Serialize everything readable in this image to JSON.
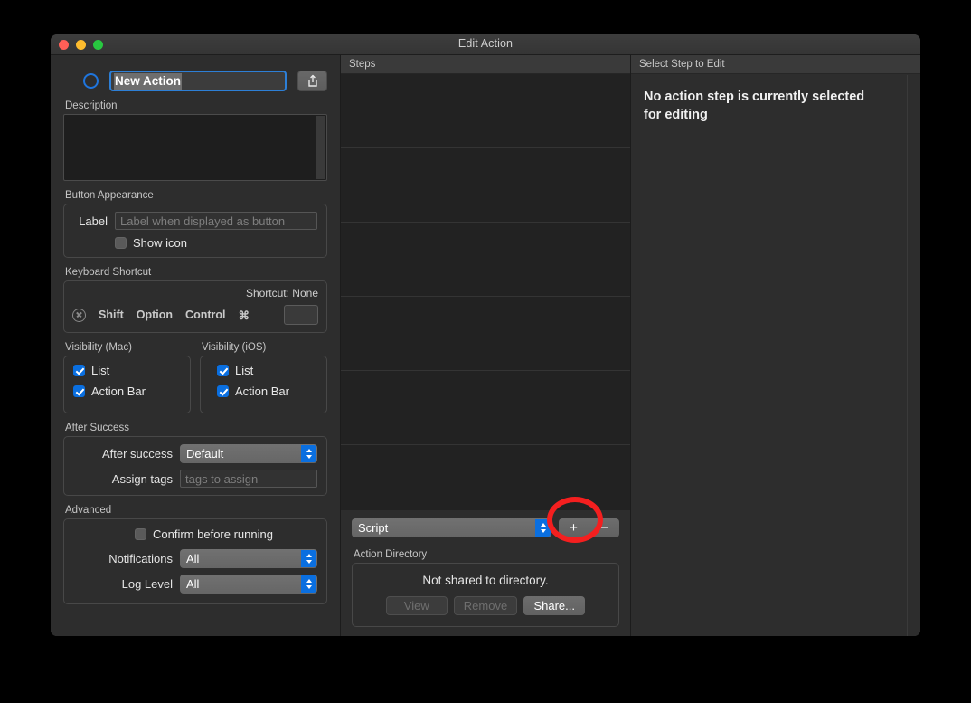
{
  "window": {
    "title": "Edit Action",
    "traffic_lights": [
      "close-button",
      "minimize-button",
      "zoom-button"
    ]
  },
  "left_panel": {
    "icon_well": "action-icon-well",
    "name_field": {
      "value": "New Action",
      "selected": true
    },
    "share_button_icon": "share-icon",
    "description": {
      "label": "Description",
      "value": "",
      "placeholder": ""
    },
    "button_appearance": {
      "label": "Button Appearance",
      "field_label": "Label",
      "field_value": "",
      "field_placeholder": "Label when displayed as button",
      "show_icon": {
        "label": "Show icon",
        "checked": false
      }
    },
    "keyboard_shortcut": {
      "label": "Keyboard Shortcut",
      "status": "Shortcut: None",
      "clear_icon": "clear-shortcut-icon",
      "modifiers": [
        "Shift",
        "Option",
        "Control",
        "⌘"
      ],
      "key_value": ""
    },
    "visibility_mac": {
      "label": "Visibility (Mac)",
      "items": [
        {
          "label": "List",
          "checked": true
        },
        {
          "label": "Action Bar",
          "checked": true
        }
      ]
    },
    "visibility_ios": {
      "label": "Visibility (iOS)",
      "items": [
        {
          "label": "List",
          "checked": true
        },
        {
          "label": "Action Bar",
          "checked": true
        }
      ]
    },
    "after_success": {
      "label": "After Success",
      "after_success_label": "After success",
      "after_success_value": "Default",
      "assign_tags_label": "Assign tags",
      "assign_tags_value": "",
      "assign_tags_placeholder": "tags to assign"
    },
    "advanced": {
      "label": "Advanced",
      "confirm_before_running": {
        "label": "Confirm before running",
        "checked": false
      },
      "notifications_label": "Notifications",
      "notifications_value": "All",
      "log_level_label": "Log Level",
      "log_level_value": "All"
    }
  },
  "middle_panel": {
    "header": "Steps",
    "steps": [],
    "empty_row_count": 6,
    "step_type_value": "Script",
    "add_button_label": "+",
    "remove_button_label": "−",
    "action_directory": {
      "label": "Action Directory",
      "status": "Not shared to directory.",
      "buttons": [
        {
          "label": "View",
          "enabled": false
        },
        {
          "label": "Remove",
          "enabled": false
        },
        {
          "label": "Share...",
          "enabled": true
        }
      ]
    }
  },
  "right_panel": {
    "header": "Select Step to Edit",
    "message": "No action step is currently selected for editing"
  },
  "annotation": {
    "shape": "ellipse",
    "color": "#f41f1f",
    "target": "add-step-button"
  }
}
